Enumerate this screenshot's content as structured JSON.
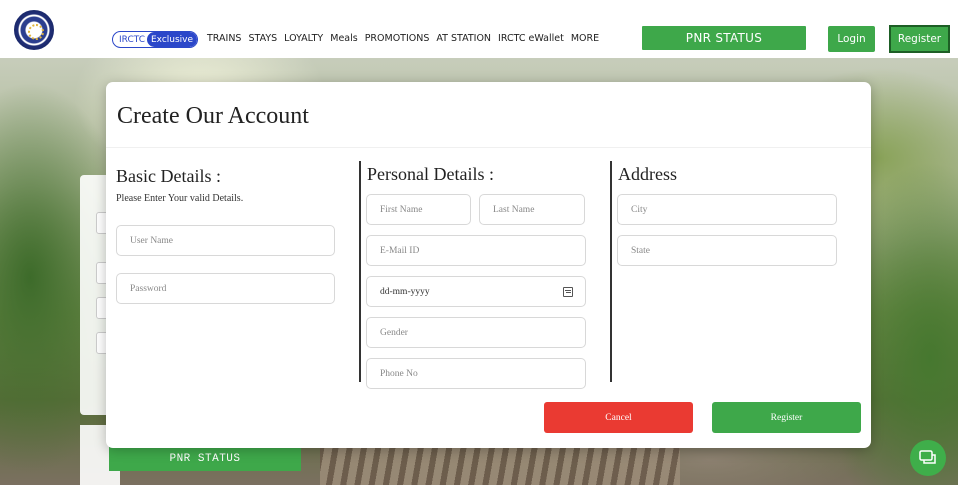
{
  "header": {
    "exclusive_irctc": "IRCTC",
    "exclusive_label": "Exclusive",
    "nav": [
      "TRAINS",
      "STAYS",
      "LOYALTY",
      "Meals",
      "PROMOTIONS",
      "AT STATION",
      "IRCTC eWallet",
      "MORE"
    ],
    "pnr_status": "PNR STATUS",
    "login": "Login",
    "register": "Register"
  },
  "background": {
    "pnr_status": "PNR STATUS"
  },
  "modal": {
    "title": "Create Our Account",
    "basic": {
      "title": "Basic Details :",
      "subtitle": "Please Enter Your valid Details.",
      "username_placeholder": "User Name",
      "password_placeholder": "Password"
    },
    "personal": {
      "title": "Personal Details :",
      "first_name_placeholder": "First Name",
      "last_name_placeholder": "Last Name",
      "email_placeholder": "E-Mail ID",
      "dob_value": "dd-mm-yyyy",
      "gender_placeholder": "Gender",
      "phone_placeholder": "Phone No"
    },
    "address": {
      "title": "Address",
      "city_placeholder": "City",
      "state_placeholder": "State"
    },
    "cancel": "Cancel",
    "register": "Register"
  },
  "colors": {
    "green": "#3ea84a",
    "red": "#ea3a32",
    "blue": "#2b47c9"
  }
}
